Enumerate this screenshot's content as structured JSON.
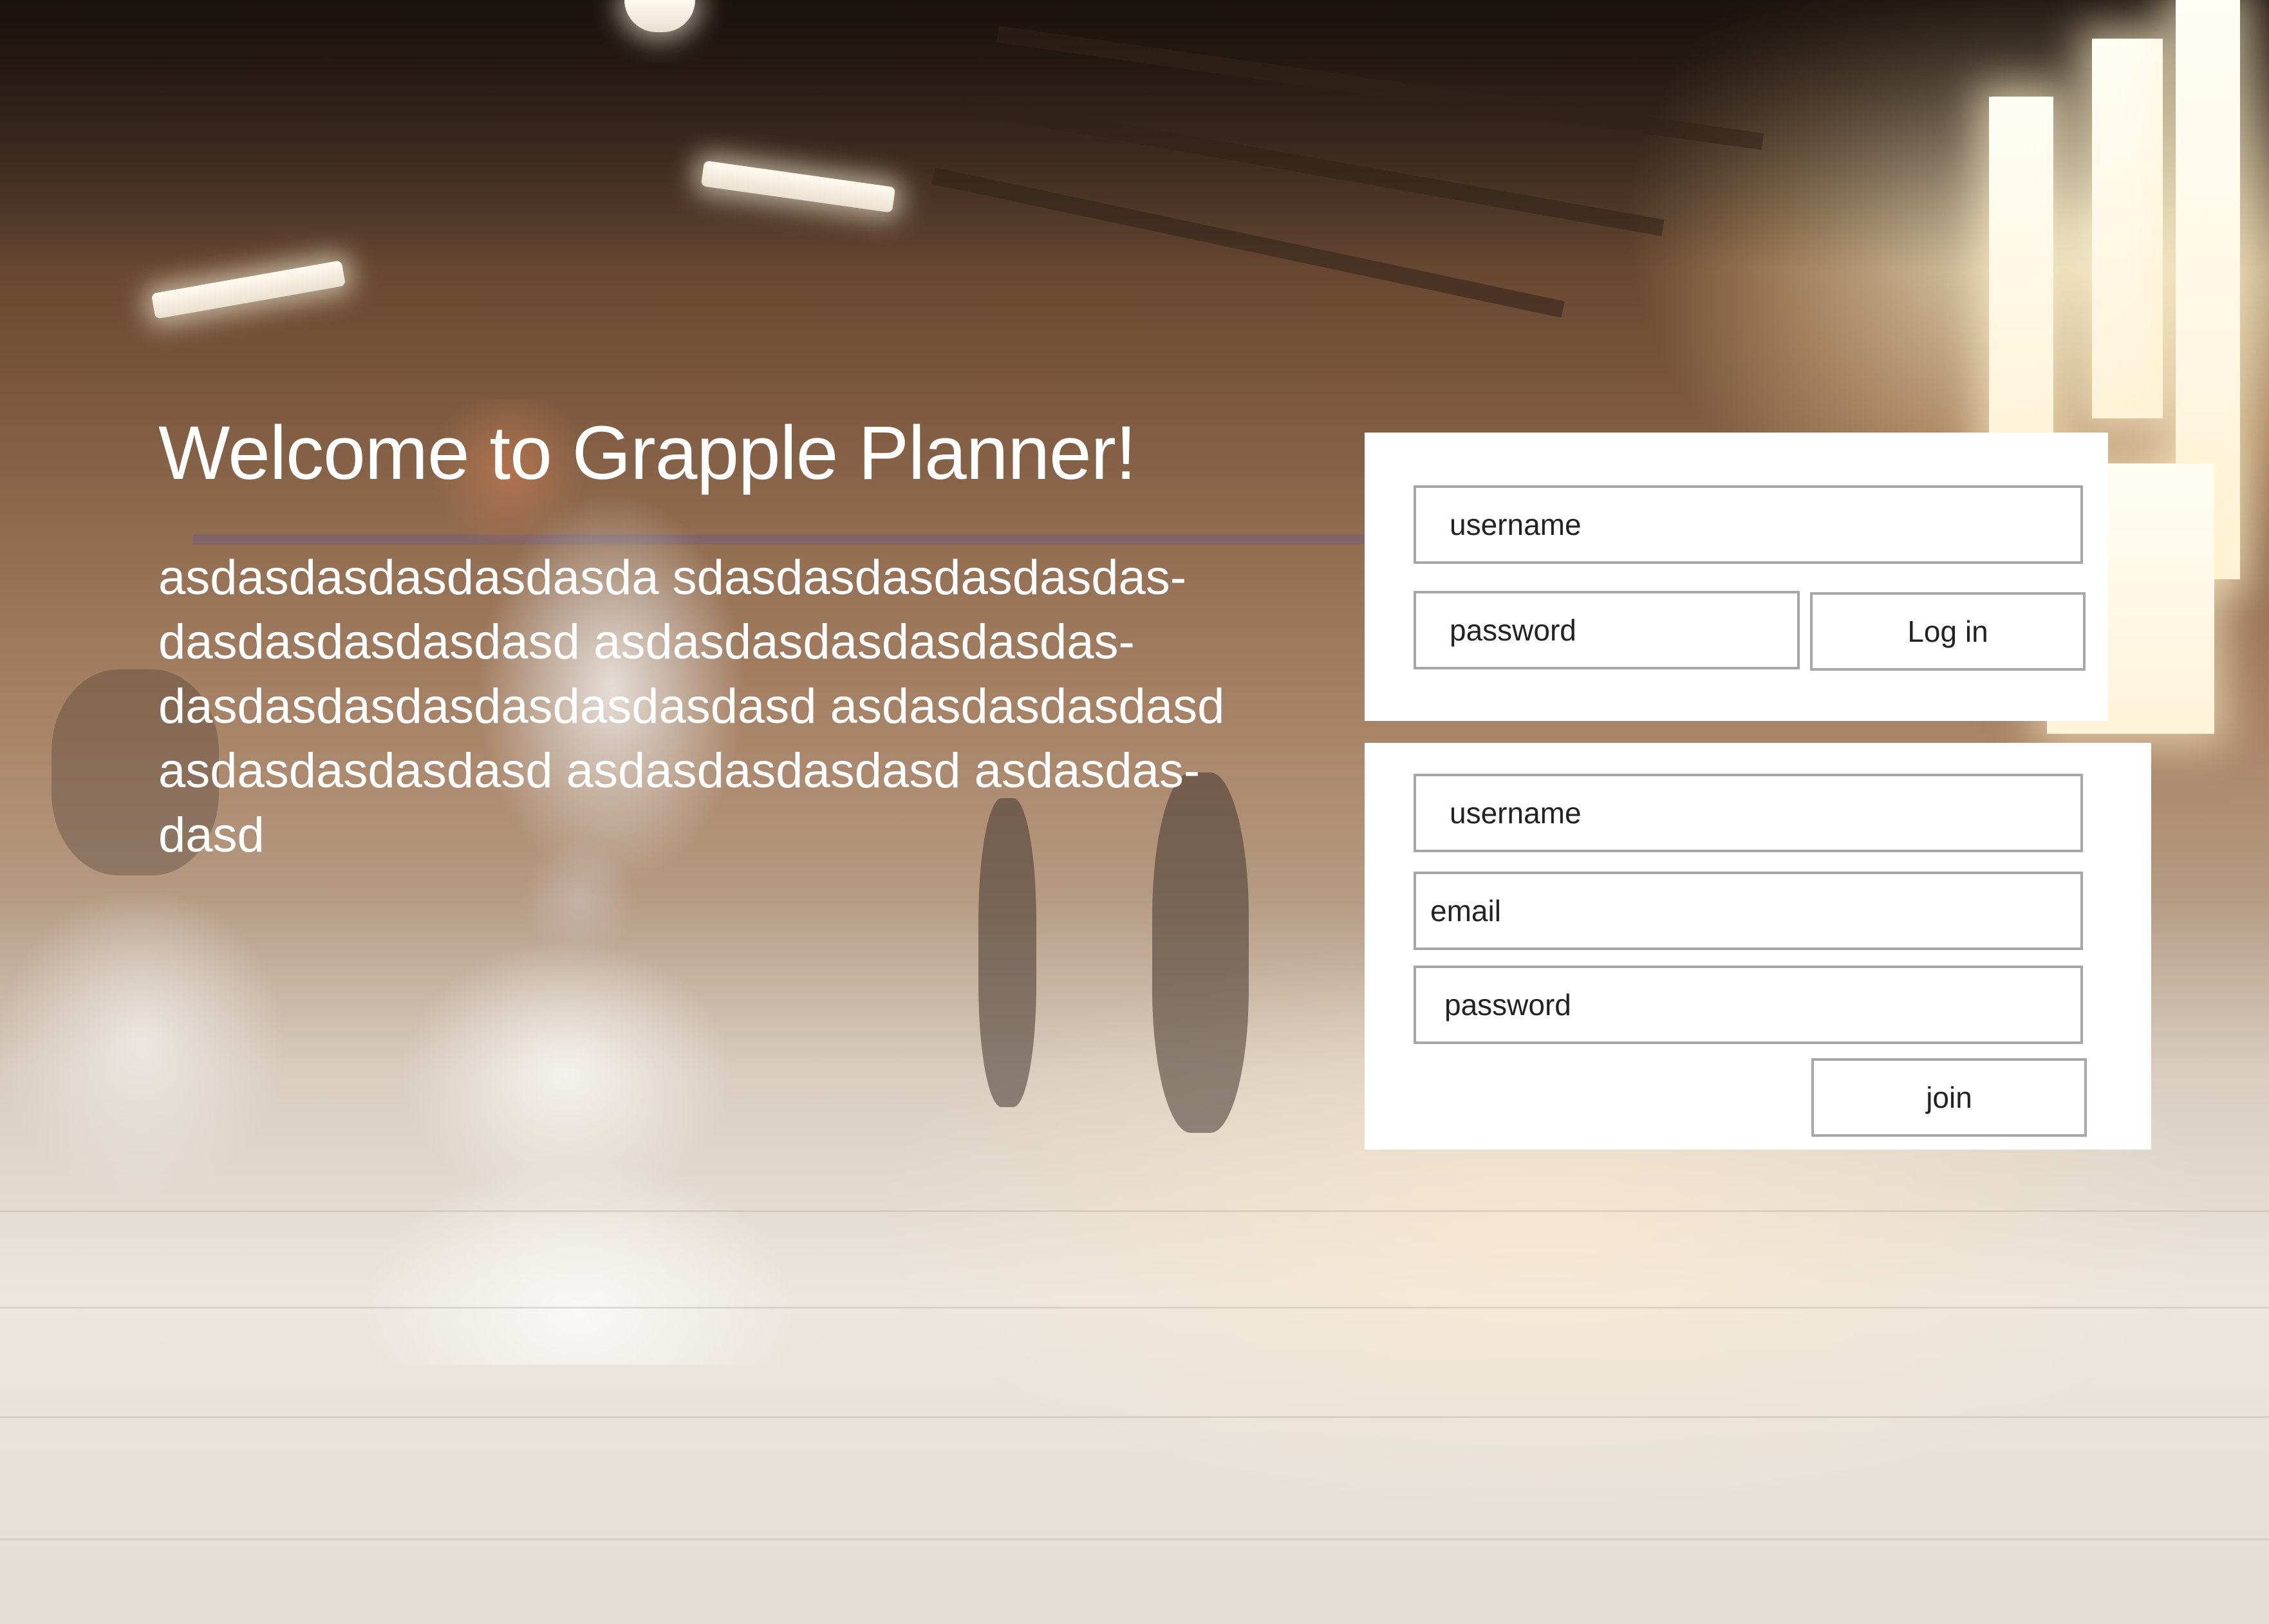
{
  "hero": {
    "title": "Welcome to Grapple Planner!",
    "body": "asdasdasdasdasdasda sdasdasdasdasdasdas-\ndasdasdasdasdasd asdasdasdasdasdasdas-\ndasdasdasdasdasdasdasdasd asdasdasdasdasd\nasdasdasdasdasd asdasdasdasdasd asdasdas-\ndasd"
  },
  "login": {
    "username_placeholder": "username",
    "password_placeholder": "password",
    "submit_label": "Log in"
  },
  "signup": {
    "username_placeholder": "username",
    "email_placeholder": "email",
    "password_placeholder": "password",
    "submit_label": "join"
  },
  "colors": {
    "panel_background": "#ffffff",
    "field_border": "#a7a7a7",
    "hero_text": "#ffffff"
  }
}
